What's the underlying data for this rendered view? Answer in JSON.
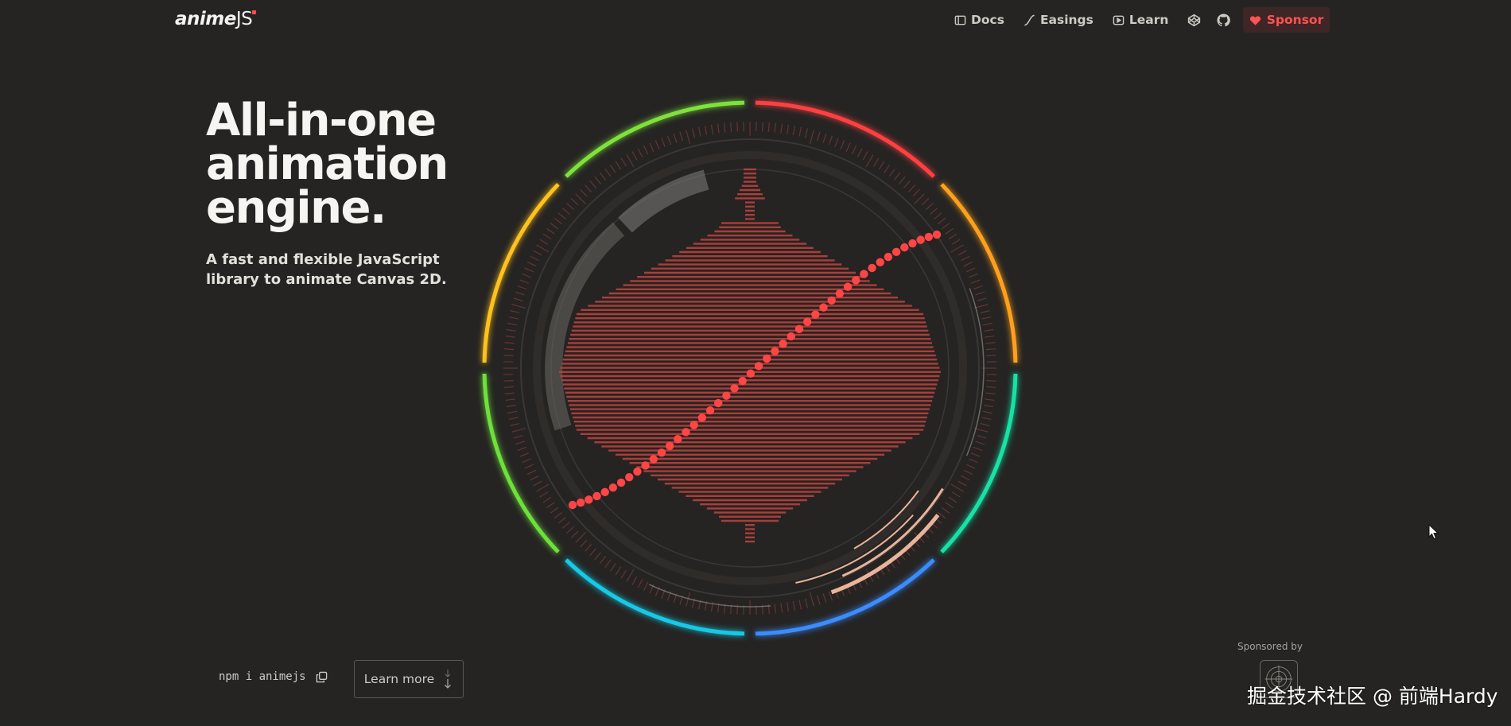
{
  "header": {
    "logo_text": "anime",
    "logo_suffix": "JS",
    "nav": [
      {
        "label": "Docs",
        "icon": "book-icon"
      },
      {
        "label": "Easings",
        "icon": "easing-curve-icon"
      },
      {
        "label": "Learn",
        "icon": "video-play-icon"
      }
    ],
    "icon_links": [
      "codepen-icon",
      "github-icon"
    ],
    "sponsor_label": "Sponsor",
    "sponsor_icon": "heart-icon"
  },
  "hero": {
    "title_lines": [
      "All-in-one",
      "animation",
      "engine."
    ],
    "subtitle_lines": [
      "A fast and flexible JavaScript",
      "library to animate Canvas 2D."
    ]
  },
  "cta": {
    "npm_command": "npm i animejs",
    "copy_icon": "copy-icon",
    "learn_more_label": "Learn more",
    "learn_more_icon": "arrow-down-icon"
  },
  "sponsors": {
    "label": "Sponsored by"
  },
  "watermark": "掘金技术社区 @ 前端Hardy",
  "colors": {
    "background": "#252423",
    "accent": "#ff4b4b",
    "ring_segments": [
      "#ff4040",
      "#ffa01e",
      "#17e2a6",
      "#3b8cff",
      "#19c9e6",
      "#6ee03a",
      "#ffc21a",
      "#7fe23a"
    ]
  }
}
